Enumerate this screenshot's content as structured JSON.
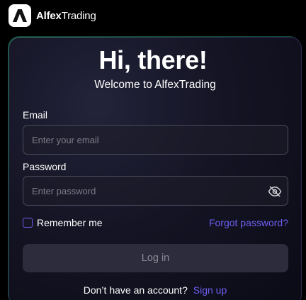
{
  "brand": {
    "name_bold": "Alfex",
    "name_rest": "Trading",
    "logo_icon": "triangle-a-logo-icon"
  },
  "header": {
    "title": "Hi, there!",
    "subtitle": "Welcome to AlfexTrading"
  },
  "form": {
    "email_label": "Email",
    "email_placeholder": "Enter your email",
    "email_value": "",
    "password_label": "Password",
    "password_placeholder": "Enter password",
    "password_value": "",
    "password_toggle_icon": "eye-slash-icon",
    "remember_label": "Remember me",
    "remember_checked": false,
    "forgot_label": "Forgot password?",
    "login_label": "Log in"
  },
  "footer": {
    "prompt": "Don’t have an account?",
    "signup_label": "Sign up"
  },
  "colors": {
    "accent": "#6e5ef0",
    "background": "#000000",
    "card": "#141424",
    "button_disabled": "#2c2c3c"
  }
}
